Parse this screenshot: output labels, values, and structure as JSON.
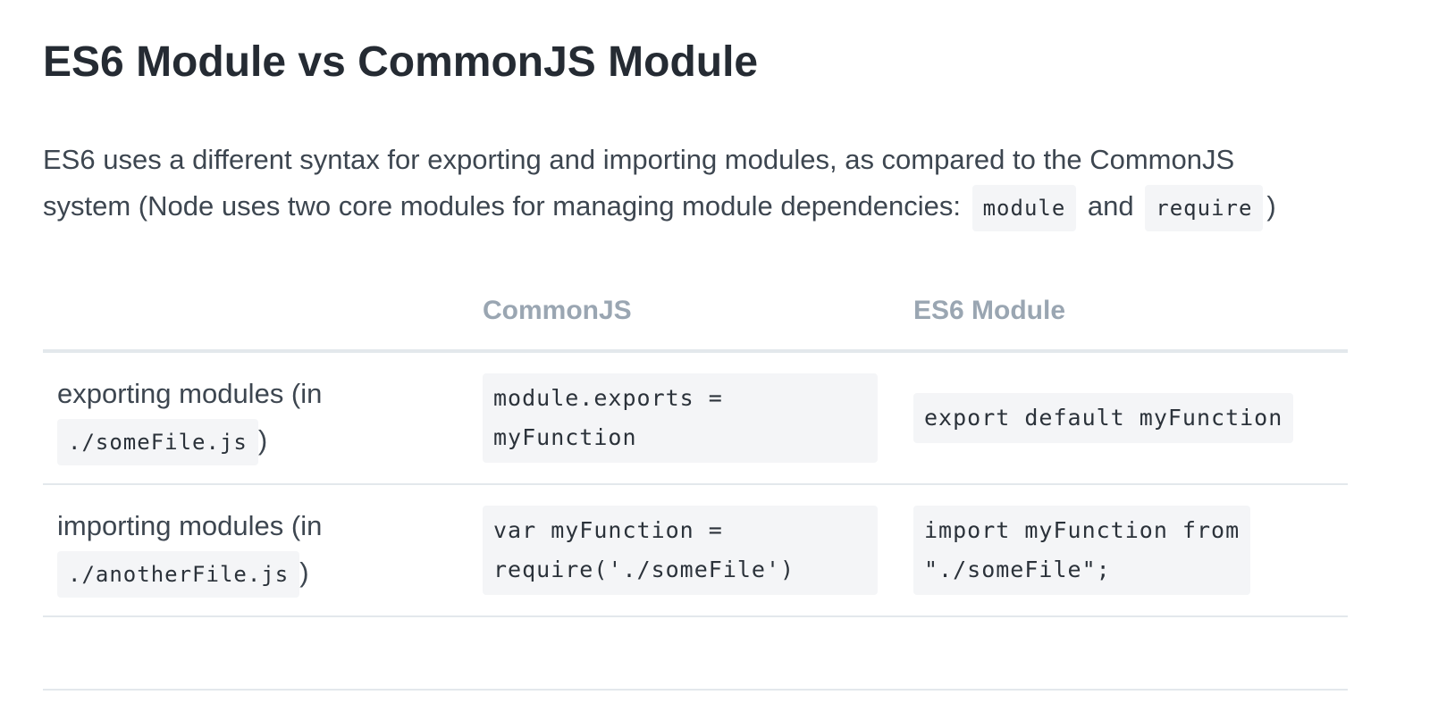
{
  "title": "ES6 Module vs CommonJS Module",
  "intro": {
    "text_before": "ES6 uses a different syntax for exporting and importing modules, as compared to the CommonJS system (Node uses two core modules for managing module dependencies: ",
    "code_1": "module",
    "text_middle": " and ",
    "code_2": "require",
    "text_after": ")"
  },
  "table": {
    "headers": [
      "",
      "CommonJS",
      "ES6 Module"
    ],
    "rows": [
      {
        "label_text": "exporting modules (in ",
        "label_code": "./someFile.js",
        "label_after": ")",
        "commonjs": "module.exports =\nmyFunction",
        "es6": "export default myFunction"
      },
      {
        "label_text": "importing modules (in ",
        "label_code": "./anotherFile.js",
        "label_after": ")",
        "commonjs": "var myFunction =\nrequire('./someFile')",
        "es6": "import myFunction from\n\"./someFile\";"
      }
    ]
  }
}
